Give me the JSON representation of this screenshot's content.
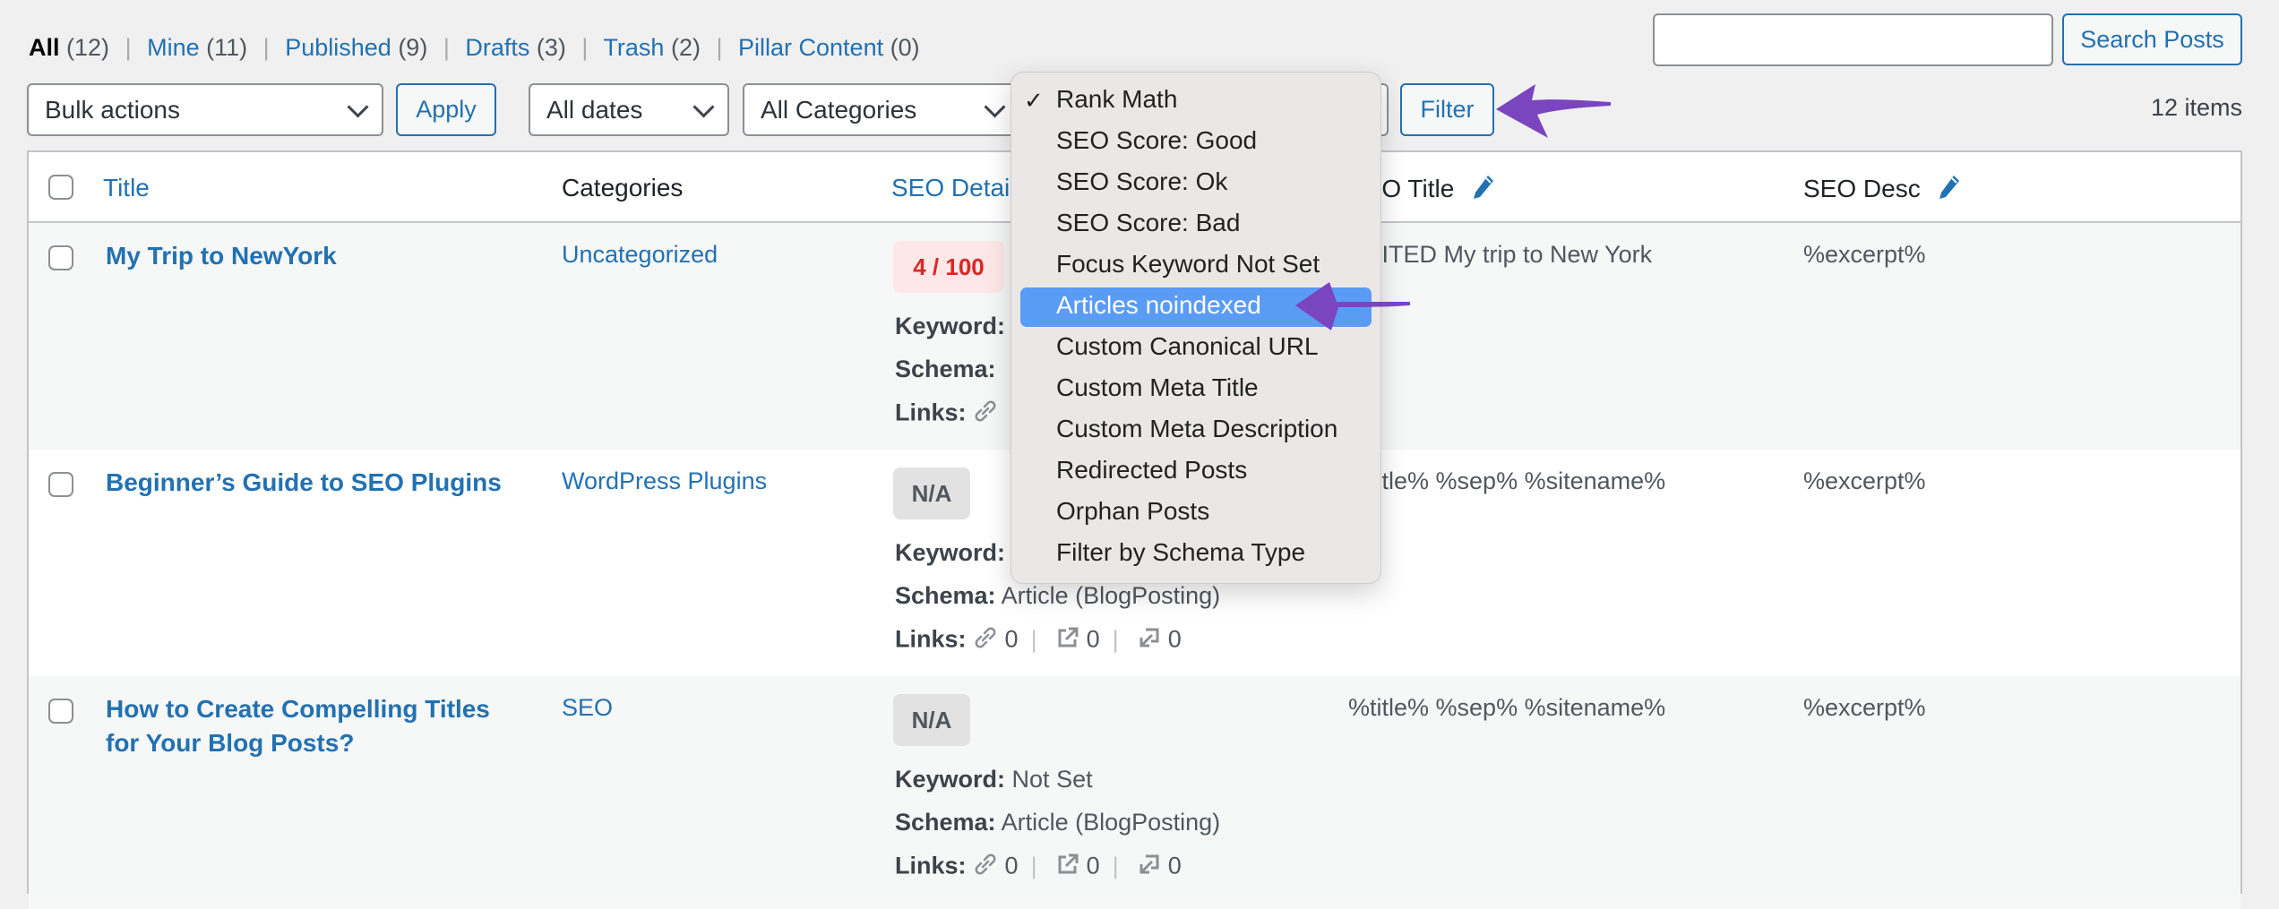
{
  "status_links": [
    {
      "label": "All",
      "count": "(12)",
      "current": true
    },
    {
      "label": "Mine",
      "count": "(11)"
    },
    {
      "label": "Published",
      "count": "(9)"
    },
    {
      "label": "Drafts",
      "count": "(3)"
    },
    {
      "label": "Trash",
      "count": "(2)"
    },
    {
      "label": "Pillar Content",
      "count": "(0)"
    }
  ],
  "search": {
    "value": "",
    "button_label": "Search Posts"
  },
  "toolbar": {
    "bulk_actions": "Bulk actions",
    "apply_label": "Apply",
    "dates": "All dates",
    "categories": "All Categories",
    "filter_label": "Filter",
    "items_count": "12 items"
  },
  "seo_filter_menu": {
    "checked": "Rank Math",
    "highlighted_index": 5,
    "items": [
      "Rank Math",
      "SEO Score: Good",
      "SEO Score: Ok",
      "SEO Score: Bad",
      "Focus Keyword Not Set",
      "Articles noindexed",
      "Custom Canonical URL",
      "Custom Meta Title",
      "Custom Meta Description",
      "Redirected Posts",
      "Orphan Posts",
      "Filter by Schema Type"
    ]
  },
  "table": {
    "columns": {
      "title": "Title",
      "categories": "Categories",
      "seo_details": "SEO Details",
      "seo_title": "SEO Title",
      "seo_desc": "SEO Desc"
    },
    "detail_labels": {
      "keyword": "Keyword:",
      "schema": "Schema:",
      "links": "Links:"
    },
    "rows": [
      {
        "title": "My Trip to NewYork",
        "category": "Uncategorized",
        "score": "4 / 100",
        "score_status": "bad",
        "keyword": "",
        "schema": "",
        "links": {
          "internal": "",
          "external": "",
          "incoming": ""
        },
        "seo_title": "EDITED My trip to New York",
        "seo_desc": "%excerpt%"
      },
      {
        "title": "Beginner’s Guide to SEO Plugins",
        "category": "WordPress Plugins",
        "score": "N/A",
        "score_status": "na",
        "keyword": "",
        "schema": "Article (BlogPosting)",
        "links": {
          "internal": "0",
          "external": "0",
          "incoming": "0"
        },
        "seo_title": "%title% %sep% %sitename%",
        "seo_desc": "%excerpt%"
      },
      {
        "title": "How to Create Compelling Titles for Your Blog Posts?",
        "category": "SEO",
        "score": "N/A",
        "score_status": "na",
        "keyword": "Not Set",
        "schema": "Article (BlogPosting)",
        "links": {
          "internal": "0",
          "external": "0",
          "incoming": "0"
        },
        "seo_title": "%title% %sep% %sitename%",
        "seo_desc": "%excerpt%"
      }
    ]
  },
  "colors": {
    "link": "#2271b1",
    "score_bad": "#dc2626",
    "menu_highlight": "#5a9bf6",
    "annotation_arrow": "#7b45c0"
  }
}
